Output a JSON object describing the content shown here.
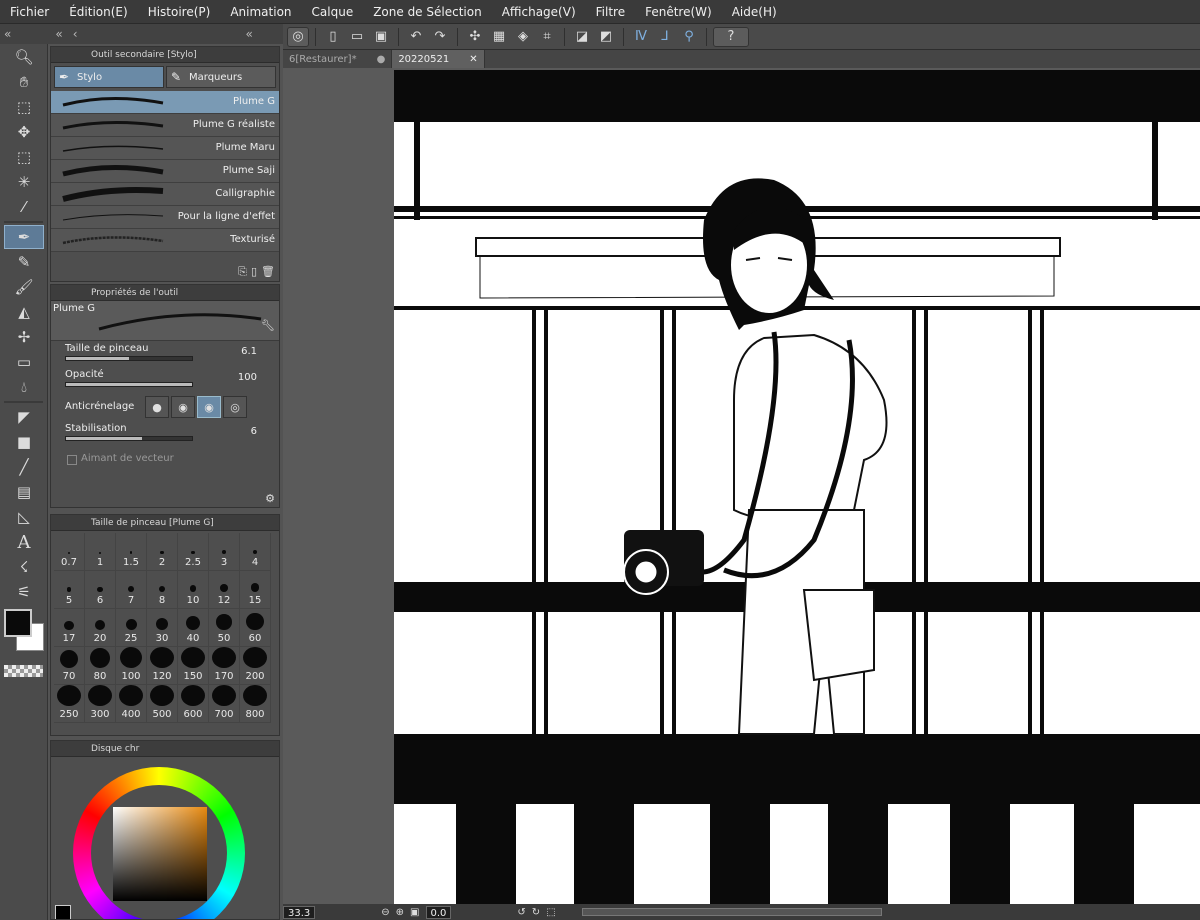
{
  "menu": [
    "Fichier",
    "Édition(E)",
    "Histoire(P)",
    "Animation",
    "Calque",
    "Zone de Sélection",
    "Affichage(V)",
    "Filtre",
    "Fenêtre(W)",
    "Aide(H)"
  ],
  "panels": {
    "subtool_title": "Outil secondaire [Stylo]",
    "subtool_tabs": [
      "Stylo",
      "Marqueurs"
    ],
    "brushes": [
      "Plume G",
      "Plume G réaliste",
      "Plume Maru",
      "Plume Saji",
      "Calligraphie",
      "Pour la ligne d'effet",
      "Texturisé"
    ],
    "props_title": "Propriétés de l'outil",
    "current_brush": "Plume G",
    "brush_size_label": "Taille de pinceau",
    "brush_size_value": "6.1",
    "opacity_label": "Opacité",
    "opacity_value": "100",
    "antialias_label": "Anticrénelage",
    "stabilisation_label": "Stabilisation",
    "stabilisation_value": "6",
    "vector_label": "Aimant de vecteur",
    "size_panel_title": "Taille de pinceau [Plume G]",
    "sizes": [
      "0.7",
      "1",
      "1.5",
      "2",
      "2.5",
      "3",
      "4",
      "5",
      "6",
      "7",
      "8",
      "10",
      "12",
      "15",
      "17",
      "20",
      "25",
      "30",
      "40",
      "50",
      "60",
      "70",
      "80",
      "100",
      "120",
      "150",
      "170",
      "200",
      "250",
      "300",
      "400",
      "500",
      "600",
      "700",
      "800"
    ],
    "color_title": "Disque chr"
  },
  "doc_tabs": [
    "6[Restaurer]*",
    "20220521"
  ],
  "status": {
    "zoom": "33.3",
    "angle": "0.0"
  },
  "colors": {
    "accent": "#6a8aa6",
    "bg": "#535353"
  }
}
